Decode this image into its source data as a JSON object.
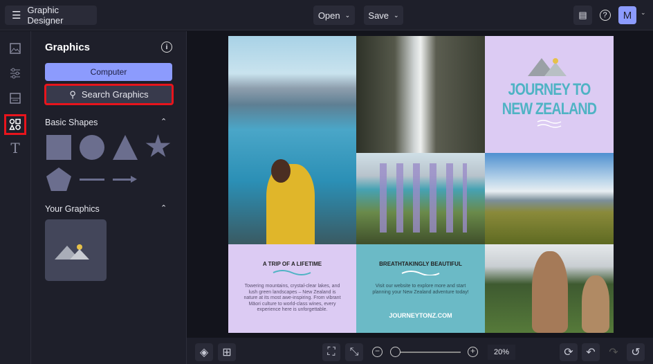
{
  "header": {
    "app_title": "Graphic Designer",
    "open_label": "Open",
    "save_label": "Save",
    "avatar_letter": "M"
  },
  "rail": {
    "items": [
      "image-icon",
      "adjustments-icon",
      "layout-icon",
      "graphics-icon",
      "text-icon"
    ],
    "active": "graphics-icon"
  },
  "panel": {
    "title": "Graphics",
    "computer_label": "Computer",
    "search_label": "Search Graphics",
    "basic_shapes_label": "Basic Shapes",
    "your_graphics_label": "Your Graphics"
  },
  "canvas": {
    "title_line1": "JOURNEY TO",
    "title_line2": "NEW ZEALAND",
    "card1": {
      "heading": "A TRIP OF A LIFETIME",
      "body": "Towering mountains, crystal-clear lakes, and lush green landscapes – New Zealand is nature at its most awe-inspiring. From vibrant Māori culture to world-class wines, every experience here is unforgettable."
    },
    "card2": {
      "heading": "BREATHTAKINGLY BEAUTIFUL",
      "body": "Visit our website to explore more and start planning your New Zealand adventure today!",
      "url": "JOURNEYTONZ.COM"
    },
    "colors": {
      "lavender": "#dccbf3",
      "teal": "#6bbac6",
      "title_teal": "#4fb3c4",
      "accent": "#8c9bfd",
      "highlight": "#e8141c"
    }
  },
  "footer": {
    "zoom": "20%",
    "zoom_fraction": 0.05
  }
}
